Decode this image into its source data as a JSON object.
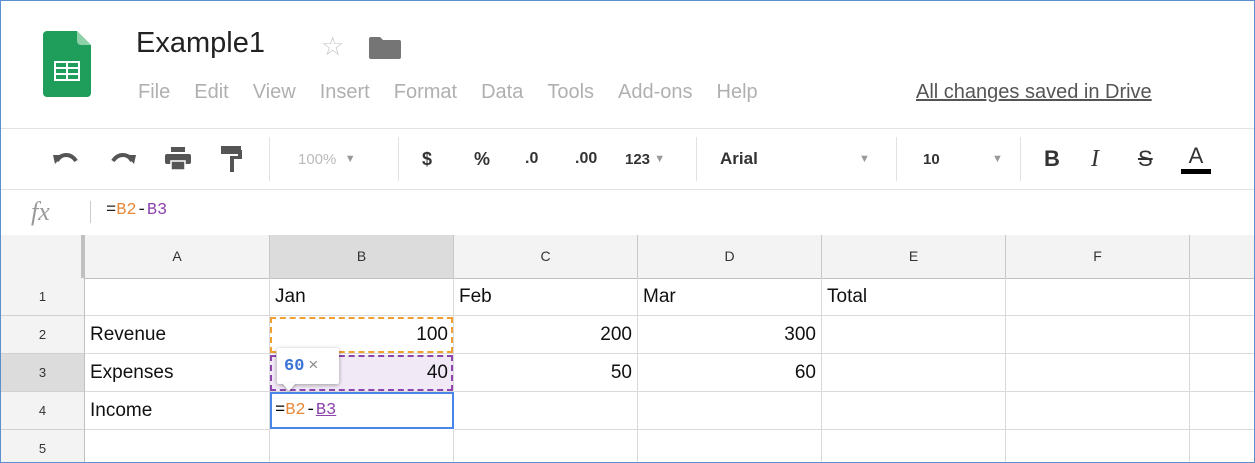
{
  "header": {
    "title": "Example1",
    "menu": [
      "File",
      "Edit",
      "View",
      "Insert",
      "Format",
      "Data",
      "Tools",
      "Add-ons",
      "Help"
    ],
    "save_status": "All changes saved in Drive"
  },
  "toolbar": {
    "zoom": "100%",
    "currency": "$",
    "percent": "%",
    "decrease_decimal": ".0",
    "increase_decimal": ".00",
    "more_formats": "123",
    "font": "Arial",
    "font_size": "10",
    "bold": "B",
    "italic": "I",
    "strikethrough": "S",
    "text_color": "A"
  },
  "formula_bar": {
    "label": "fx",
    "prefix": "=",
    "ref1": "B2",
    "op": "-",
    "ref2": "B3"
  },
  "columns": [
    "A",
    "B",
    "C",
    "D",
    "E",
    "F"
  ],
  "rows": [
    "1",
    "2",
    "3",
    "4",
    "5"
  ],
  "cells": {
    "B1": "Jan",
    "C1": "Feb",
    "D1": "Mar",
    "E1": "Total",
    "A2": "Revenue",
    "B2": "100",
    "C2": "200",
    "D2": "300",
    "A3": "Expenses",
    "B3": "40",
    "C3": "50",
    "D3": "60",
    "A4": "Income"
  },
  "tooltip": {
    "value": "60",
    "close": "×"
  }
}
